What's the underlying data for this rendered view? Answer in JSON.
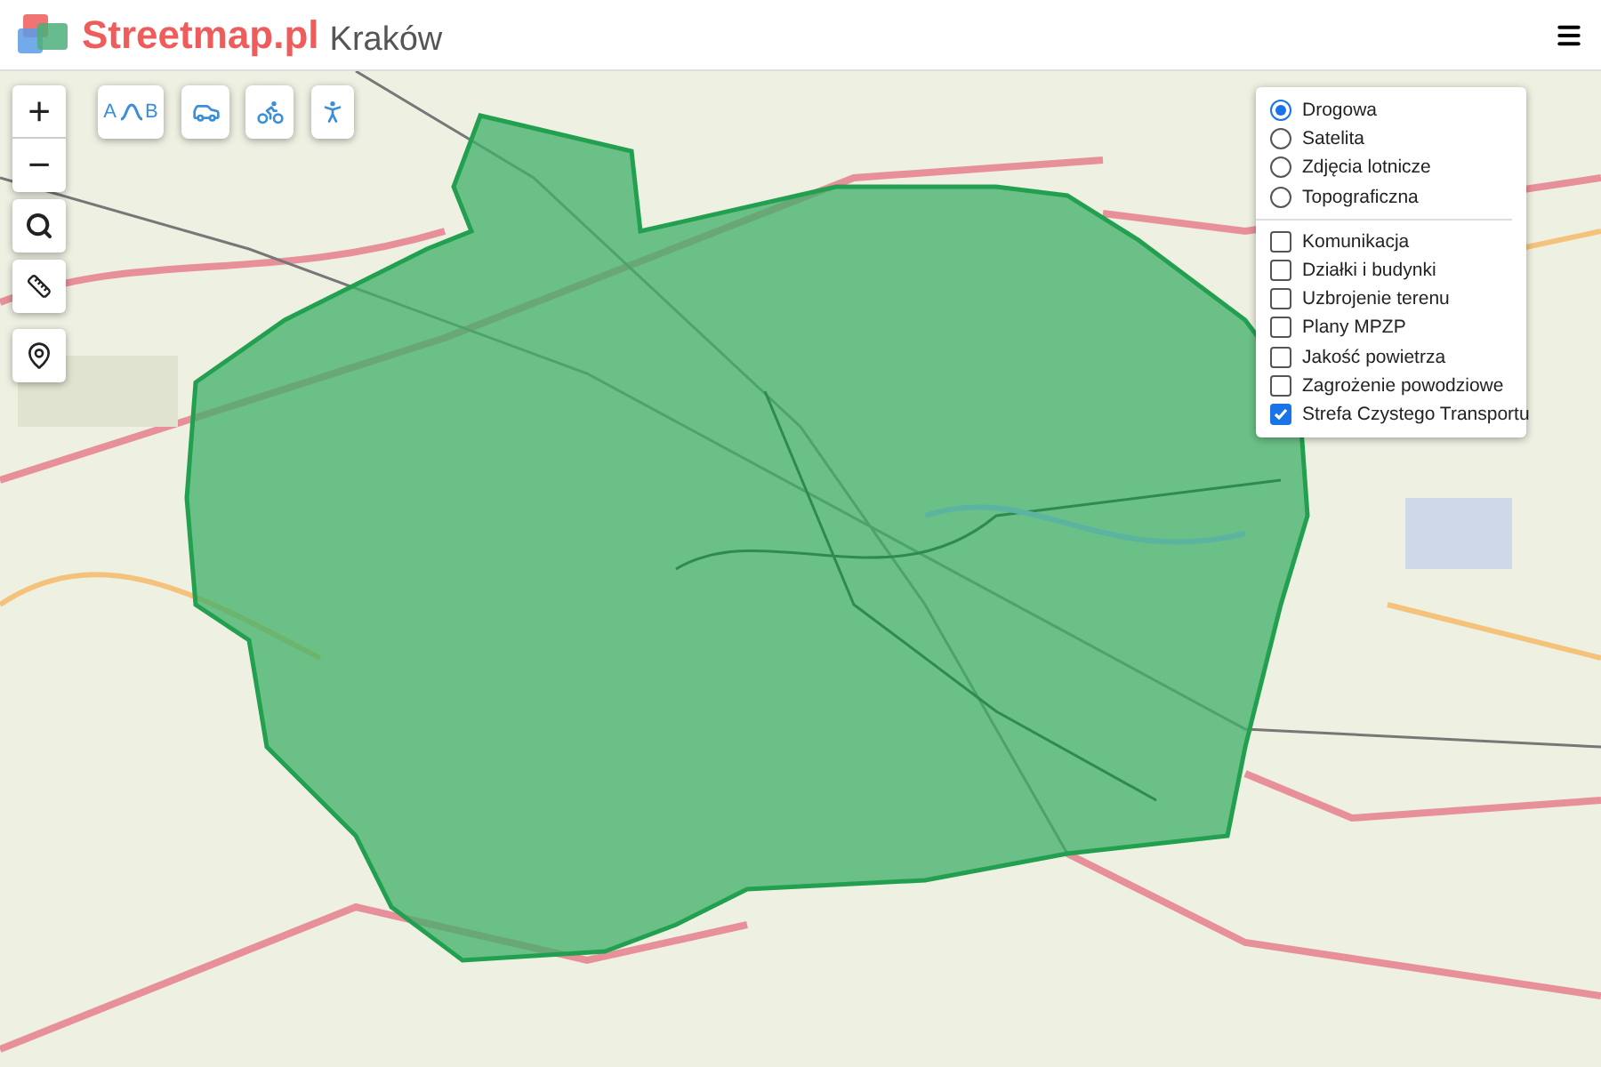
{
  "header": {
    "brand": "Streetmap.pl",
    "city": "Kraków"
  },
  "zoom_controls": [
    "+",
    "−"
  ],
  "route_button": {
    "from": "A",
    "to": "B"
  },
  "map_types": [
    {
      "label": "Drogowa",
      "selected": true
    },
    {
      "label": "Satelita",
      "selected": false
    },
    {
      "label": "Zdjęcia lotnicze",
      "selected": false
    },
    {
      "label": "Topograficzna",
      "selected": false
    }
  ],
  "layers": [
    {
      "label": "Komunikacja",
      "checked": false
    },
    {
      "label": "Działki i budynki",
      "checked": false
    },
    {
      "label": "Uzbrojenie terenu",
      "checked": false
    },
    {
      "label": "Plany MPZP",
      "checked": false
    },
    {
      "label": "Jakość powietrza",
      "checked": false
    },
    {
      "label": "Zagrożenie powodziowe",
      "checked": false
    },
    {
      "label": "Strefa Czystego Transportu",
      "checked": true
    }
  ]
}
